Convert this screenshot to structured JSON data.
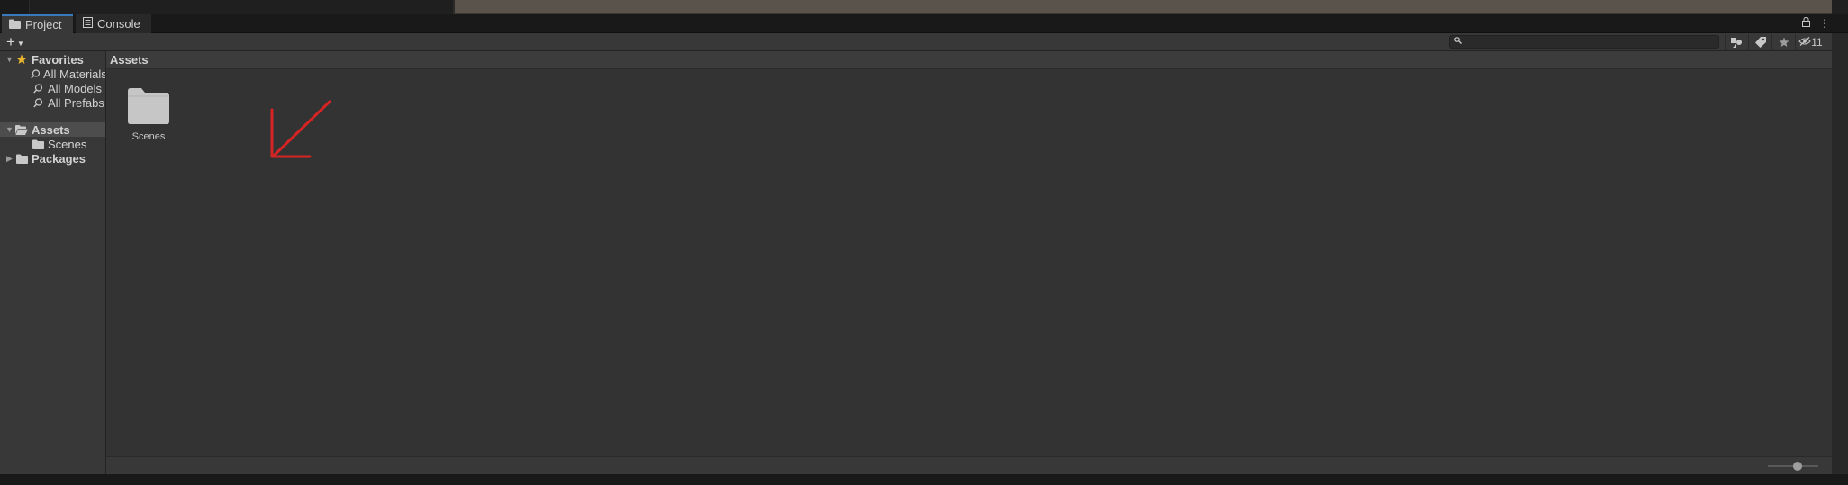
{
  "tabs": [
    {
      "label": "Project",
      "icon": "folder-icon",
      "active": true
    },
    {
      "label": "Console",
      "icon": "console-icon",
      "active": false
    }
  ],
  "toolbar": {
    "add_label": "+",
    "search_placeholder": "",
    "hidden_count": "11"
  },
  "tree": {
    "favorites": {
      "label": "Favorites",
      "items": [
        "All Materials",
        "All Models",
        "All Prefabs"
      ]
    },
    "assets": {
      "label": "Assets",
      "children": [
        "Scenes"
      ]
    },
    "packages": {
      "label": "Packages"
    }
  },
  "main": {
    "breadcrumb": "Assets",
    "items": [
      {
        "label": "Scenes",
        "icon": "folder-icon"
      }
    ]
  },
  "colors": {
    "accent": "#3a79bb",
    "annotation_arrow": "#d42424",
    "favorites_star": "#e8b52c"
  }
}
